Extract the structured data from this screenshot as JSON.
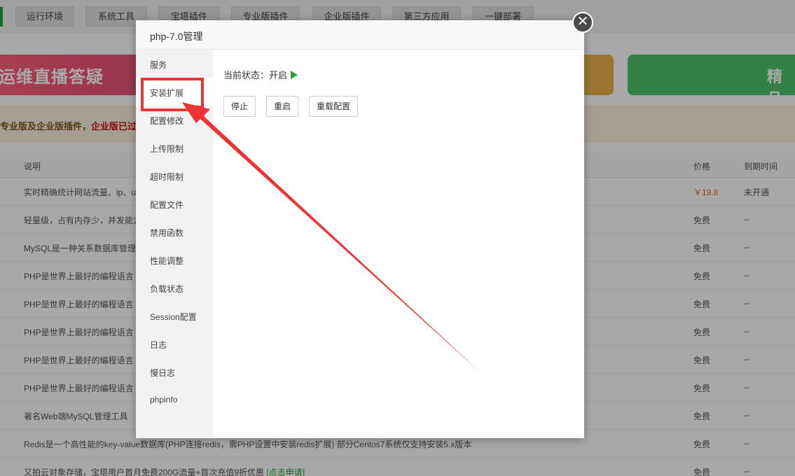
{
  "top_tabs": [
    "运行环境",
    "系统工具",
    "宝塔插件",
    "专业版插件",
    "企业版插件",
    "第三方应用",
    "一键部署"
  ],
  "banners": {
    "left_text": "运维直播答疑",
    "right_text": "精品"
  },
  "notice": {
    "text_start": "专业版及企业版插件，",
    "text_red": "企业版已过期"
  },
  "table": {
    "columns": {
      "desc": "说明",
      "price": "价格",
      "expire": "到期时间"
    },
    "rows": [
      {
        "desc": "实时精确统计网站流量、ip、uv",
        "price": "￥19.8",
        "expire": "未开通"
      },
      {
        "desc": "轻量级，占有内存少，并发能力强",
        "price": "免费",
        "expire": "--"
      },
      {
        "desc": "MySQL是一种关系数据库管理系统",
        "price": "免费",
        "expire": "--"
      },
      {
        "desc": "PHP是世界上最好的编程语言",
        "price": "免费",
        "expire": "--"
      },
      {
        "desc": "PHP是世界上最好的编程语言",
        "price": "免费",
        "expire": "--"
      },
      {
        "desc": "PHP是世界上最好的编程语言",
        "price": "免费",
        "expire": "--"
      },
      {
        "desc": "PHP是世界上最好的编程语言",
        "price": "免费",
        "expire": "--"
      },
      {
        "desc": "PHP是世界上最好的编程语言",
        "price": "免费",
        "expire": "--"
      },
      {
        "desc": "著名Web端MySQL管理工具",
        "price": "免费",
        "expire": "--"
      },
      {
        "desc": "Redis是一个高性能的key-value数据库(PHP连接redis，需PHP设置中安装redis扩展) 部分Centos7系统仅支持安装5.x版本",
        "price": "免费",
        "expire": "--"
      },
      {
        "desc": "又拍云对象存储，宝塔用户首月免费200G流量+首次充值9折优惠 ",
        "link": "[点击申请]",
        "price": "免费",
        "expire": "--"
      }
    ]
  },
  "modal": {
    "title": "php-7.0管理",
    "close_glyph": "✕",
    "side_items": [
      "服务",
      "安装扩展",
      "配置修改",
      "上传限制",
      "超时限制",
      "配置文件",
      "禁用函数",
      "性能调整",
      "负载状态",
      "Session配置",
      "日志",
      "慢日志",
      "phpinfo"
    ],
    "active_index": 1,
    "status_label": "当前状态：",
    "status_value": "开启",
    "buttons": {
      "stop": "停止",
      "restart": "重启",
      "reload": "重载配置"
    }
  },
  "colors": {
    "accent_green": "#20a53a",
    "annotation_red": "#ee3333",
    "price_red": "#e95f2b"
  },
  "icons": {
    "status": "play-icon",
    "close": "close-icon",
    "annotation": "arrow-annotation"
  }
}
